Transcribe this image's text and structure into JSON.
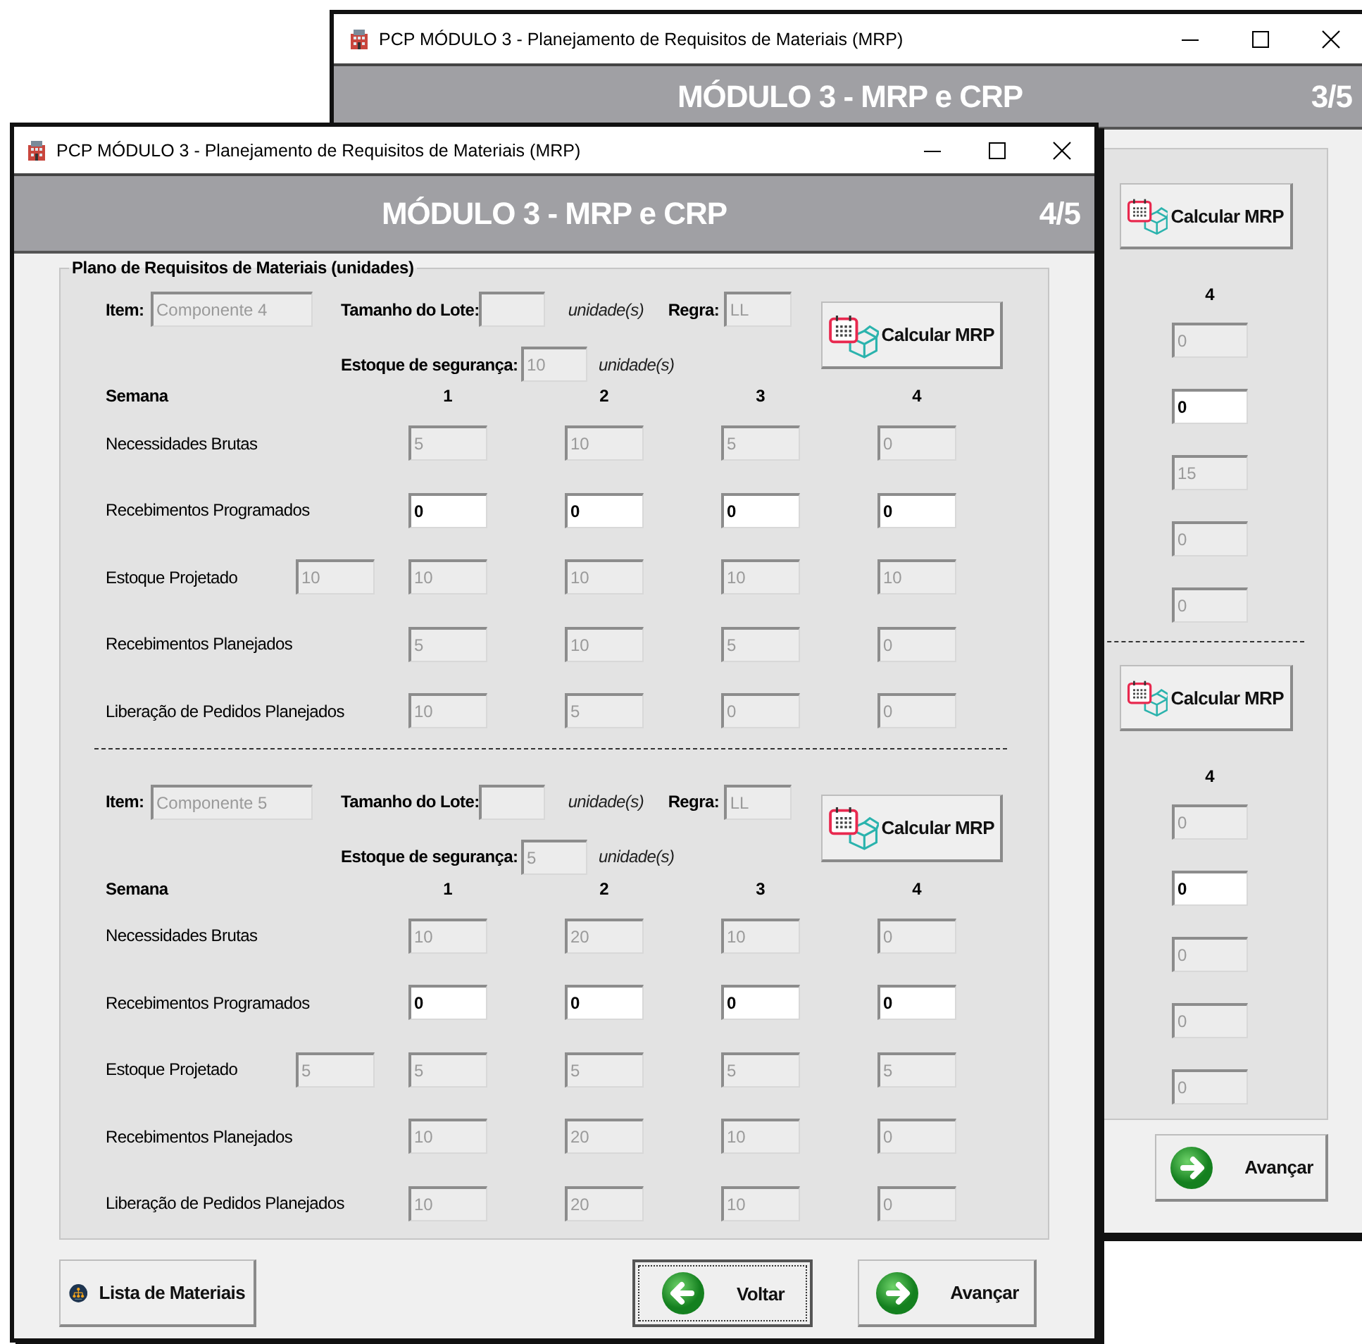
{
  "back_window": {
    "title": "PCP MÓDULO 3 - Planejamento de Requisitos de Materiais (MRP)",
    "heading": "MÓDULO 3 - MRP e CRP",
    "page": "3/5",
    "components": [
      {
        "calc_button": "Calcular MRP",
        "week": "4",
        "cells": [
          {
            "value": "0",
            "editable": false
          },
          {
            "value": "0",
            "editable": true
          },
          {
            "value": "15",
            "editable": false
          },
          {
            "value": "0",
            "editable": false
          },
          {
            "value": "0",
            "editable": false
          }
        ]
      },
      {
        "calc_button": "Calcular MRP",
        "week": "4",
        "cells": [
          {
            "value": "0",
            "editable": false
          },
          {
            "value": "0",
            "editable": true
          },
          {
            "value": "0",
            "editable": false
          },
          {
            "value": "0",
            "editable": false
          },
          {
            "value": "0",
            "editable": false
          }
        ]
      }
    ],
    "buttons": [
      {
        "label": "Avançar",
        "kind": "next",
        "focused": false
      }
    ]
  },
  "front_window": {
    "title": "PCP MÓDULO 3 - Planejamento de Requisitos de Materiais (MRP)",
    "heading": "MÓDULO 3 - MRP e CRP",
    "page": "4/5",
    "group_title": "Plano de Requisitos de Materiais (unidades)",
    "components": [
      {
        "item_label": "Item:",
        "item": "Componente 4",
        "lot_label": "Tamanho do Lote:",
        "lot_unit": "unidade(s)",
        "rule_label": "Regra:",
        "rule": "LL",
        "safety_label": "Estoque de segurança:",
        "safety_stock": "10",
        "safety_unit": "unidade(s)",
        "calc_button": "Calcular MRP",
        "week_label": "Semana",
        "weeks": [
          "1",
          "2",
          "3",
          "4"
        ],
        "rows": [
          {
            "label": "Necessidades Brutas",
            "cells": [
              {
                "value": "5",
                "editable": false
              },
              {
                "value": "10",
                "editable": false
              },
              {
                "value": "5",
                "editable": false
              },
              {
                "value": "0",
                "editable": false
              }
            ]
          },
          {
            "label": "Recebimentos Programados",
            "cells": [
              {
                "value": "0",
                "editable": true
              },
              {
                "value": "0",
                "editable": true
              },
              {
                "value": "0",
                "editable": true
              },
              {
                "value": "0",
                "editable": true
              }
            ]
          },
          {
            "label": "Estoque Projetado",
            "initial": "10",
            "cells": [
              {
                "value": "10",
                "editable": false
              },
              {
                "value": "10",
                "editable": false
              },
              {
                "value": "10",
                "editable": false
              },
              {
                "value": "10",
                "editable": false
              }
            ]
          },
          {
            "label": "Recebimentos Planejados",
            "cells": [
              {
                "value": "5",
                "editable": false
              },
              {
                "value": "10",
                "editable": false
              },
              {
                "value": "5",
                "editable": false
              },
              {
                "value": "0",
                "editable": false
              }
            ]
          },
          {
            "label": "Liberação de Pedidos Planejados",
            "cells": [
              {
                "value": "10",
                "editable": false
              },
              {
                "value": "5",
                "editable": false
              },
              {
                "value": "0",
                "editable": false
              },
              {
                "value": "0",
                "editable": false
              }
            ]
          }
        ]
      },
      {
        "item_label": "Item:",
        "item": "Componente 5",
        "lot_label": "Tamanho do Lote:",
        "lot_unit": "unidade(s)",
        "rule_label": "Regra:",
        "rule": "LL",
        "safety_label": "Estoque de segurança:",
        "safety_stock": "5",
        "safety_unit": "unidade(s)",
        "calc_button": "Calcular MRP",
        "week_label": "Semana",
        "weeks": [
          "1",
          "2",
          "3",
          "4"
        ],
        "rows": [
          {
            "label": "Necessidades Brutas",
            "cells": [
              {
                "value": "10",
                "editable": false
              },
              {
                "value": "20",
                "editable": false
              },
              {
                "value": "10",
                "editable": false
              },
              {
                "value": "0",
                "editable": false
              }
            ]
          },
          {
            "label": "Recebimentos Programados",
            "cells": [
              {
                "value": "0",
                "editable": true
              },
              {
                "value": "0",
                "editable": true
              },
              {
                "value": "0",
                "editable": true
              },
              {
                "value": "0",
                "editable": true
              }
            ]
          },
          {
            "label": "Estoque Projetado",
            "initial": "5",
            "cells": [
              {
                "value": "5",
                "editable": false
              },
              {
                "value": "5",
                "editable": false
              },
              {
                "value": "5",
                "editable": false
              },
              {
                "value": "5",
                "editable": false
              }
            ]
          },
          {
            "label": "Recebimentos Planejados",
            "cells": [
              {
                "value": "10",
                "editable": false
              },
              {
                "value": "20",
                "editable": false
              },
              {
                "value": "10",
                "editable": false
              },
              {
                "value": "0",
                "editable": false
              }
            ]
          },
          {
            "label": "Liberação de Pedidos Planejados",
            "cells": [
              {
                "value": "10",
                "editable": false
              },
              {
                "value": "20",
                "editable": false
              },
              {
                "value": "10",
                "editable": false
              },
              {
                "value": "0",
                "editable": false
              }
            ]
          }
        ]
      }
    ],
    "buttons": [
      {
        "label": "Lista de Materiais",
        "kind": "tree",
        "focused": false
      },
      {
        "label": "Voltar",
        "kind": "back",
        "focused": true
      },
      {
        "label": "Avançar",
        "kind": "next",
        "focused": false
      }
    ]
  }
}
